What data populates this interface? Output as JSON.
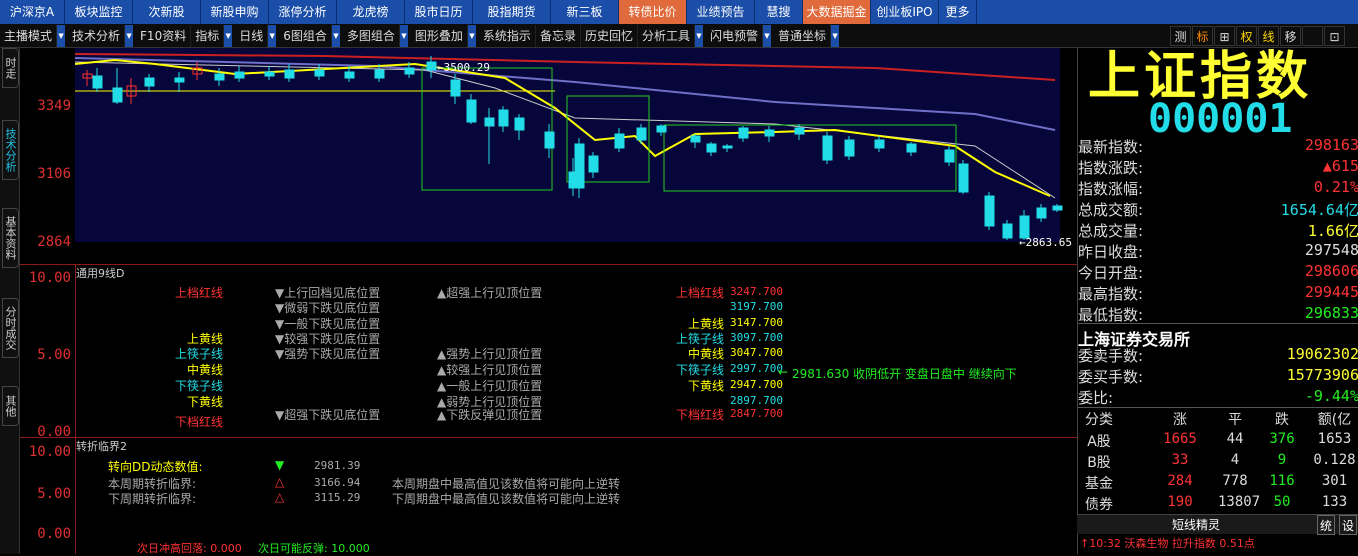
{
  "topnav": [
    "沪深京A",
    "板块监控",
    "次新股",
    "新股申购",
    "涨停分析",
    "龙虎榜",
    "股市日历",
    "股指期货",
    "新三板",
    "转债比价",
    "业绩预告",
    "慧搜",
    "大数据掘金",
    "创业板IPO",
    "更多"
  ],
  "toolbar": {
    "items": [
      "主播模式",
      "技术分析",
      "F10资料",
      "指标",
      "日线",
      "6图组合",
      "多图组合",
      "图形叠加",
      "系统指示",
      "备忘录",
      "历史回忆",
      "分析工具",
      "闪电预警",
      "普通坐标"
    ],
    "right": [
      "测",
      "标",
      "⊞",
      "权",
      "线",
      "移",
      "",
      "⊡"
    ]
  },
  "lefttabs": [
    "时走势",
    "技术分析",
    "基本资料",
    "分时成交",
    "其他"
  ],
  "main_chart": {
    "y_labels": [
      "3349",
      "3106",
      "2864"
    ],
    "hi_label": "3500.29",
    "lo_label": "2863.65"
  },
  "panel1": {
    "title": "通用9线D",
    "ylabels": [
      "10.00",
      "5.00",
      "0.00"
    ],
    "left_labels": [
      {
        "t": "上档红线",
        "c": "red"
      },
      {
        "t": "上黄线",
        "c": "yel"
      },
      {
        "t": "上筷子线",
        "c": "cyan"
      },
      {
        "t": "中黄线",
        "c": "yel"
      },
      {
        "t": "下筷子线",
        "c": "cyan"
      },
      {
        "t": "下黄线",
        "c": "yel"
      },
      {
        "t": "下档红线",
        "c": "red"
      }
    ],
    "mid_labels": [
      "▼上行回档见底位置",
      "▼微弱下跌见底位置",
      "▼一般下跌见底位置",
      "▼较强下跌见底位置",
      "▼强势下跌见底位置",
      "▼超强下跌见底位置"
    ],
    "mid2_labels": [
      "▲超强上行见顶位置",
      "▲强势上行见顶位置",
      "▲较强上行见顶位置",
      "▲一般上行见顶位置",
      "▲弱势上行见顶位置",
      "▲下跌反弹见顶位置"
    ],
    "right_labels": [
      {
        "t": "上档红线",
        "v": "3247.700",
        "c": "red"
      },
      {
        "t": "",
        "v": "3197.700",
        "c": "cyan"
      },
      {
        "t": "上黄线",
        "v": "3147.700",
        "c": "yel"
      },
      {
        "t": "上筷子线",
        "v": "3097.700",
        "c": "cyan"
      },
      {
        "t": "中黄线",
        "v": "3047.700",
        "c": "yel"
      },
      {
        "t": "下筷子线",
        "v": "2997.700",
        "c": "cyan"
      },
      {
        "t": "下黄线",
        "v": "2947.700",
        "c": "yel"
      },
      {
        "t": "",
        "v": "2897.700",
        "c": "cyan"
      },
      {
        "t": "下档红线",
        "v": "2847.700",
        "c": "red"
      }
    ],
    "note": "2981.630 收阴低开 变盘日盘中 继续向下"
  },
  "panel2": {
    "title": "转折临界2",
    "ylabels": [
      "10.00",
      "5.00",
      "0.00"
    ],
    "rows": [
      {
        "label": "转向DD动态数值:",
        "v": "2981.39",
        "txt": ""
      },
      {
        "label": "本周期转折临界:",
        "v": "3166.94",
        "txt": "本周期盘中最高值见该数值将可能向上逆转"
      },
      {
        "label": "下周期转折临界:",
        "v": "3115.29",
        "txt": "下周期盘中最高值见该数值将可能向上逆转"
      }
    ]
  },
  "bottom": {
    "a": "次日冲高回落: 0.000",
    "b": "次日可能反弹: 10.000"
  },
  "right": {
    "name": "上证指数",
    "code": "000001",
    "rows": [
      {
        "k": "最新指数:",
        "v": "298163",
        "c": "#ff3333"
      },
      {
        "k": "指数涨跌:",
        "v": "▲615",
        "c": "#ff3333"
      },
      {
        "k": "指数涨幅:",
        "v": "0.21%",
        "c": "#ff3333"
      },
      {
        "k": "总成交额:",
        "v": "1654.64亿",
        "c": "#22dde8"
      },
      {
        "k": "总成交量:",
        "v": "1.66亿",
        "c": "#ffff33"
      },
      {
        "k": "昨日收盘:",
        "v": "297548",
        "c": "#ddd"
      },
      {
        "k": "今日开盘:",
        "v": "298606",
        "c": "#ff3333"
      },
      {
        "k": "最高指数:",
        "v": "299445",
        "c": "#ff3333"
      },
      {
        "k": "最低指数:",
        "v": "296833",
        "c": "#22ee22"
      }
    ],
    "exchange": "上海证券交易所",
    "rows2": [
      {
        "k": "委卖手数:",
        "v": "19062302",
        "c": "#ffff33"
      },
      {
        "k": "委买手数:",
        "v": "15773906",
        "c": "#ffff33"
      },
      {
        "k": "委比:",
        "v": "-9.44%",
        "c": "#22ee22"
      }
    ],
    "table": {
      "head": [
        "分类",
        "涨",
        "平",
        "跌",
        "额(亿"
      ],
      "rows": [
        [
          "A股",
          "1665",
          "44",
          "376",
          "1653"
        ],
        [
          "B股",
          "33",
          "4",
          "9",
          "0.128"
        ],
        [
          "基金",
          "284",
          "778",
          "116",
          "301"
        ],
        [
          "债券",
          "190",
          "13807",
          "50",
          "133"
        ]
      ]
    },
    "footer": {
      "title": "短线精灵",
      "b1": "统",
      "b2": "设"
    },
    "ticker": "↑10:32 沃森生物 拉升指数 0.51点"
  }
}
